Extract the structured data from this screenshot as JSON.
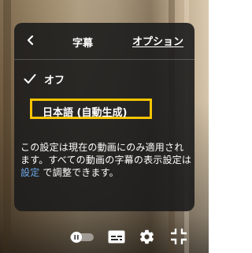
{
  "menu": {
    "title": "字幕",
    "options_label": "オプション",
    "back_icon": "chevron-left-icon",
    "items": [
      {
        "label": "オフ",
        "selected": true,
        "highlighted": false
      },
      {
        "label": "日本語 (自動生成)",
        "selected": false,
        "highlighted": true
      }
    ],
    "note": {
      "before": "この設定は現在の動画にのみ適用されます。すべての動画の字幕の表示設定は ",
      "link": "設定",
      "after": " で調整できます。"
    }
  },
  "controls": {
    "autoplay_toggle": "autoplay-toggle",
    "subtitles_icon": "subtitles-icon",
    "settings_icon": "gear-icon",
    "fullscreen_exit_icon": "exit-fullscreen-icon"
  },
  "colors": {
    "highlight_border": "#f5c400",
    "link": "#6ea8e6",
    "panel": "#1c1c1c"
  }
}
